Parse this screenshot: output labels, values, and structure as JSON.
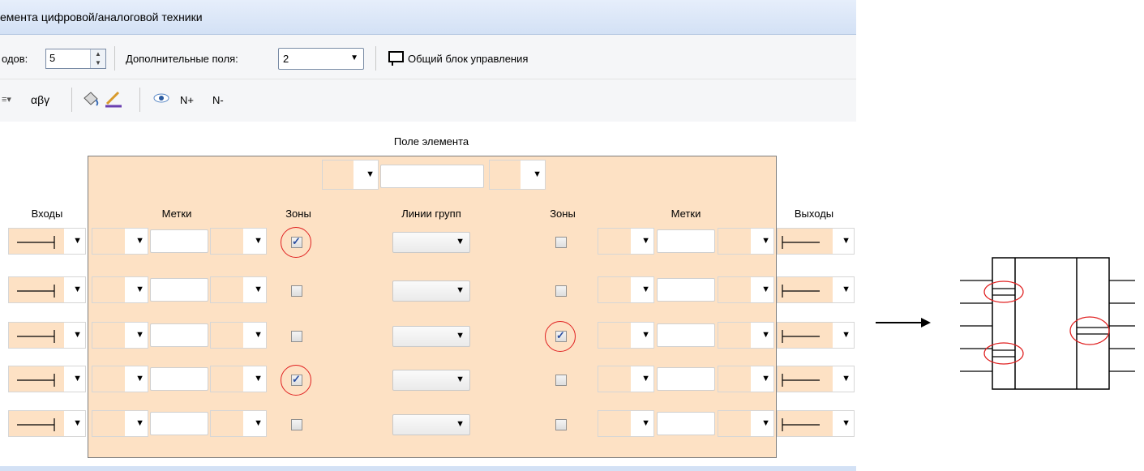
{
  "title": "емента цифровой/аналоговой техники",
  "toolbar1": {
    "count_label": "одов:",
    "count_value": "5",
    "extra_fields_label": "Дополнительные поля:",
    "extra_fields_value": "2",
    "common_block_label": "Общий блок управления"
  },
  "toolbar2": {
    "greek_label": "αβγ",
    "n_plus": "N+",
    "n_minus": "N-"
  },
  "panel": {
    "field_title": "Поле элемента",
    "headers": {
      "inputs": "Входы",
      "labels_left": "Метки",
      "zones_left": "Зоны",
      "group_lines": "Линии групп",
      "zones_right": "Зоны",
      "labels_right": "Метки",
      "outputs": "Выходы"
    },
    "rows": [
      {
        "zone_left_checked": true,
        "zone_right_checked": false
      },
      {
        "zone_left_checked": false,
        "zone_right_checked": false
      },
      {
        "zone_left_checked": false,
        "zone_right_checked": true
      },
      {
        "zone_left_checked": true,
        "zone_right_checked": false
      },
      {
        "zone_left_checked": false,
        "zone_right_checked": false
      }
    ]
  }
}
